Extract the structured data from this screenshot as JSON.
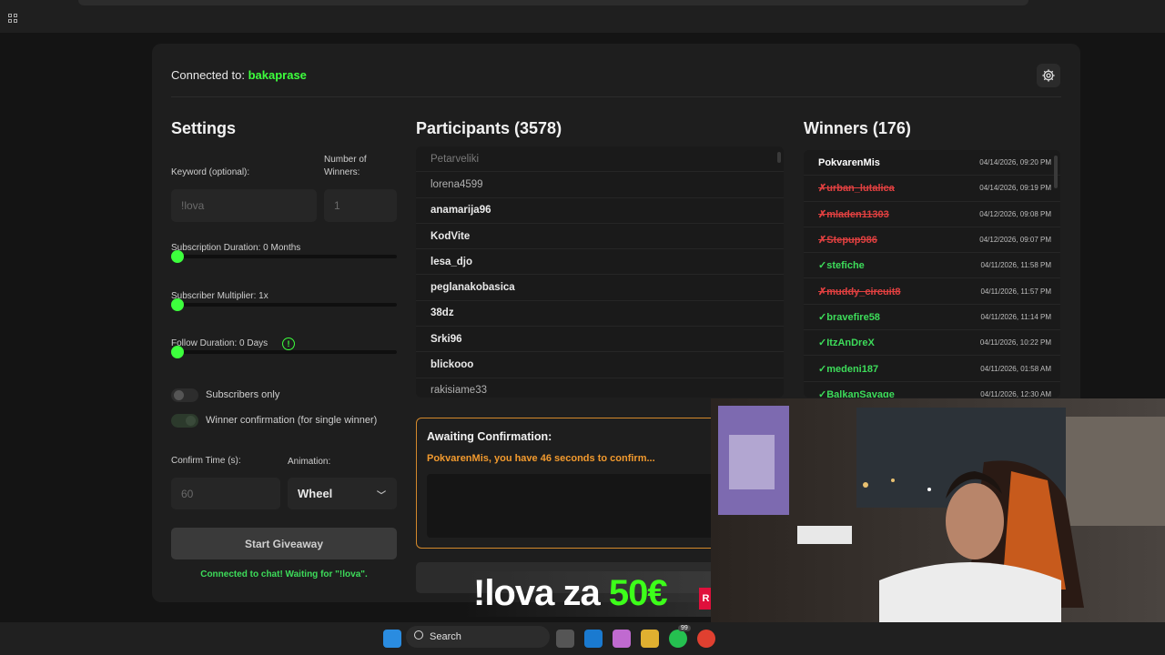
{
  "connection": {
    "prefix": "Connected to:",
    "channel": "bakaprase"
  },
  "settings": {
    "title": "Settings",
    "keyword_label": "Keyword (optional):",
    "keyword_placeholder": "!lova",
    "winners_label_1": "Number of",
    "winners_label_2": "Winners:",
    "winners_placeholder": "1",
    "sub_duration_label": "Subscription Duration: 0 Months",
    "sub_duration_value": 0,
    "sub_multiplier_label": "Subscriber Multiplier: 1x",
    "sub_multiplier_value": 1,
    "follow_label": "Follow Duration:  0  Days",
    "follow_value": 0,
    "subscribers_only_label": "Subscribers only",
    "winner_confirm_label": "Winner confirmation (for single winner)",
    "confirm_time_label": "Confirm Time (s):",
    "confirm_time_placeholder": "60",
    "animation_label": "Animation:",
    "animation_value": "Wheel",
    "start_button": "Start Giveaway",
    "status": "Connected to chat! Waiting for \"!lova\"."
  },
  "participants": {
    "title": "Participants (3578)",
    "items": [
      "Petarveliki",
      "lorena4599",
      "anamarija96",
      "KodVite",
      "lesa_djo",
      "peglanakobasica",
      "38dz",
      "Srki96",
      "blickooo",
      "rakisiame33"
    ]
  },
  "winners": {
    "title": "Winners (176)",
    "items": [
      {
        "name": "PokvarenMis",
        "date": "04/14/2026, 09:20 PM",
        "status": "first",
        "mark": ""
      },
      {
        "name": "urban_lutalica",
        "date": "04/14/2026, 09:19 PM",
        "status": "bad",
        "mark": "✗"
      },
      {
        "name": "mladen11303",
        "date": "04/12/2026, 09:08 PM",
        "status": "bad",
        "mark": "✗"
      },
      {
        "name": "Stepup986",
        "date": "04/12/2026, 09:07 PM",
        "status": "bad",
        "mark": "✗"
      },
      {
        "name": "stefiche",
        "date": "04/11/2026, 11:58 PM",
        "status": "ok",
        "mark": "✓"
      },
      {
        "name": "muddy_circuit8",
        "date": "04/11/2026, 11:57 PM",
        "status": "bad",
        "mark": "✗"
      },
      {
        "name": "bravefire58",
        "date": "04/11/2026, 11:14 PM",
        "status": "ok",
        "mark": "✓"
      },
      {
        "name": "ItzAnDreX",
        "date": "04/11/2026, 10:22 PM",
        "status": "ok",
        "mark": "✓"
      },
      {
        "name": "medeni187",
        "date": "04/11/2026, 01:58 AM",
        "status": "ok",
        "mark": "✓"
      },
      {
        "name": "BalkanSavage",
        "date": "04/11/2026, 12:30 AM",
        "status": "ok",
        "mark": "✓"
      }
    ]
  },
  "awaiting": {
    "title": "Awaiting Confirmation:",
    "message": "PokvarenMis, you have 46 seconds to confirm..."
  },
  "overlay": {
    "text_main": "!lova za ",
    "text_price": "50€",
    "tag": "R"
  },
  "taskbar": {
    "search": "Search",
    "badge": "99"
  },
  "colors": {
    "accent": "#3dff3d",
    "warning": "#f29a2e",
    "error": "#e04040",
    "success": "#3ddc5a"
  }
}
